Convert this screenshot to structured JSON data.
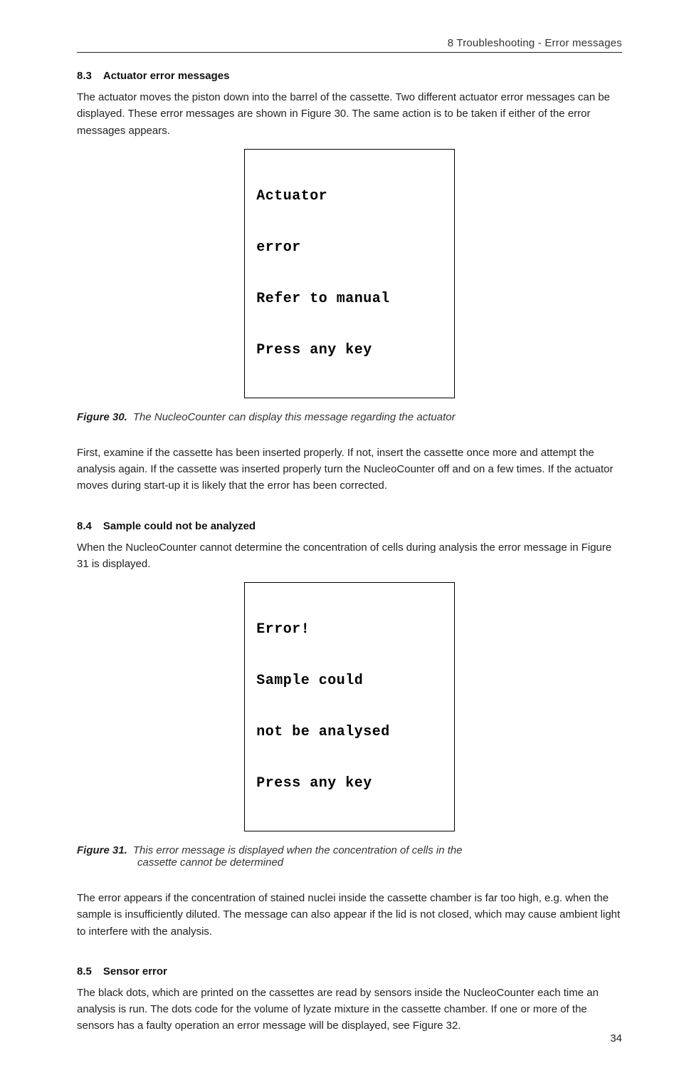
{
  "header": {
    "running": "8 Troubleshooting - Error messages"
  },
  "sections": {
    "s83": {
      "num": "8.3",
      "title": "Actuator error messages",
      "p1": "The actuator moves the piston down into the barrel of the cassette. Two different actuator error messages can be displayed. These error messages are shown in Figure 30. The same action is to be taken if either of the error messages appears.",
      "p2": "First, examine if the cassette has been inserted properly. If not, insert the cassette once more and attempt the analysis again. If the cassette was inserted properly turn the NucleoCounter off and on a few times. If the actuator moves during start-up it is likely that the error has been corrected."
    },
    "s84": {
      "num": "8.4",
      "title": "Sample could not be analyzed",
      "p1": "When the NucleoCounter cannot determine the concentration of cells during analysis the error message in Figure 31 is displayed.",
      "p2": "The error appears if the concentration of stained nuclei inside the cassette chamber is far too high, e.g. when the sample is insufficiently diluted. The message can also appear if the lid is not closed, which may cause ambient light to interfere with the analysis."
    },
    "s85": {
      "num": "8.5",
      "title": "Sensor error",
      "p1": "The black dots, which are printed on the cassettes are read by sensors inside the NucleoCounter each time an analysis is run. The dots code for the volume of lyzate mixture in the cassette chamber. If one or more of the sensors has a faulty operation an error message will be displayed, see Figure 32."
    }
  },
  "figures": {
    "fig30": {
      "label": "Figure 30.",
      "caption": "The NucleoCounter can display this message regarding the actuator",
      "lcd": {
        "l1": "Actuator",
        "l2": "error",
        "l3": "Refer to manual",
        "l4": "Press any key"
      }
    },
    "fig31": {
      "label": "Figure 31.",
      "caption_line1": "This error message is displayed when the concentration of cells in the",
      "caption_line2": "cassette cannot be determined",
      "lcd": {
        "l1": "Error!",
        "l2": "Sample could",
        "l3": "not be analysed",
        "l4": "Press any key"
      }
    }
  },
  "page_number": "34"
}
